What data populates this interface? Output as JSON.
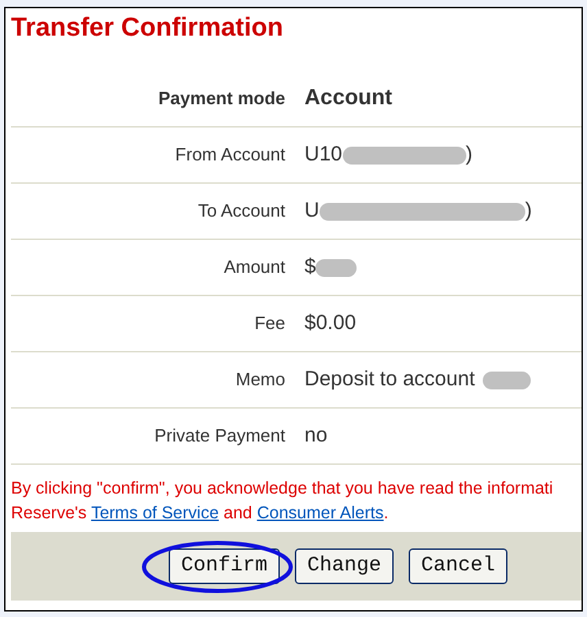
{
  "title": "Transfer Confirmation",
  "rows": [
    {
      "label": "Payment mode",
      "value": "Account",
      "kind": "heading"
    },
    {
      "label": "From Account",
      "value": "U10",
      "redacted": true,
      "value_end": ")",
      "kind": "plain"
    },
    {
      "label": "To Account",
      "value": "U",
      "redacted": true,
      "value_end": ")",
      "kind": "plain"
    },
    {
      "label": "Amount",
      "value": "$",
      "redacted": true,
      "kind": "plain"
    },
    {
      "label": "Fee",
      "value": "$0.00",
      "kind": "plain"
    },
    {
      "label": "Memo",
      "value": "Deposit to account",
      "redacted": true,
      "kind": "plain"
    },
    {
      "label": "Private Payment",
      "value": "no",
      "kind": "plain"
    }
  ],
  "notice": {
    "before": "By clicking \"confirm\", you acknowledge that you have read the informati",
    "middle": "Reserve's",
    "link_1": "Terms of Service",
    "and": "and",
    "link_2": "Consumer Alerts",
    "end": "."
  },
  "buttons": [
    {
      "label": "Confirm",
      "highlighted": true
    },
    {
      "label": "Change",
      "highlighted": false
    },
    {
      "label": "Cancel",
      "highlighted": false
    }
  ]
}
